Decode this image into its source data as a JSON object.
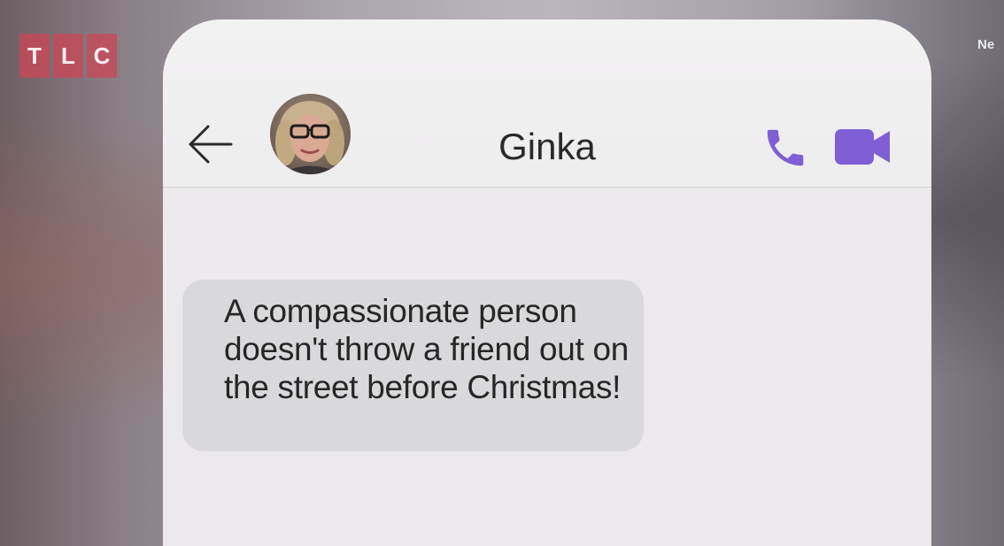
{
  "overlay": {
    "channel_logo": [
      "T",
      "L",
      "C"
    ],
    "corner_text": "Ne"
  },
  "chat": {
    "contact_name": "Ginka",
    "messages": [
      {
        "direction": "incoming",
        "text": "A compassionate person doesn't throw a friend out on the street before Christmas!"
      }
    ]
  },
  "icons": {
    "back": "back-arrow-icon",
    "call": "phone-icon",
    "video": "video-camera-icon"
  },
  "colors": {
    "accent": "#7e5fd4",
    "channel_logo": "#cd4655",
    "bubble": "#d9d8da"
  }
}
